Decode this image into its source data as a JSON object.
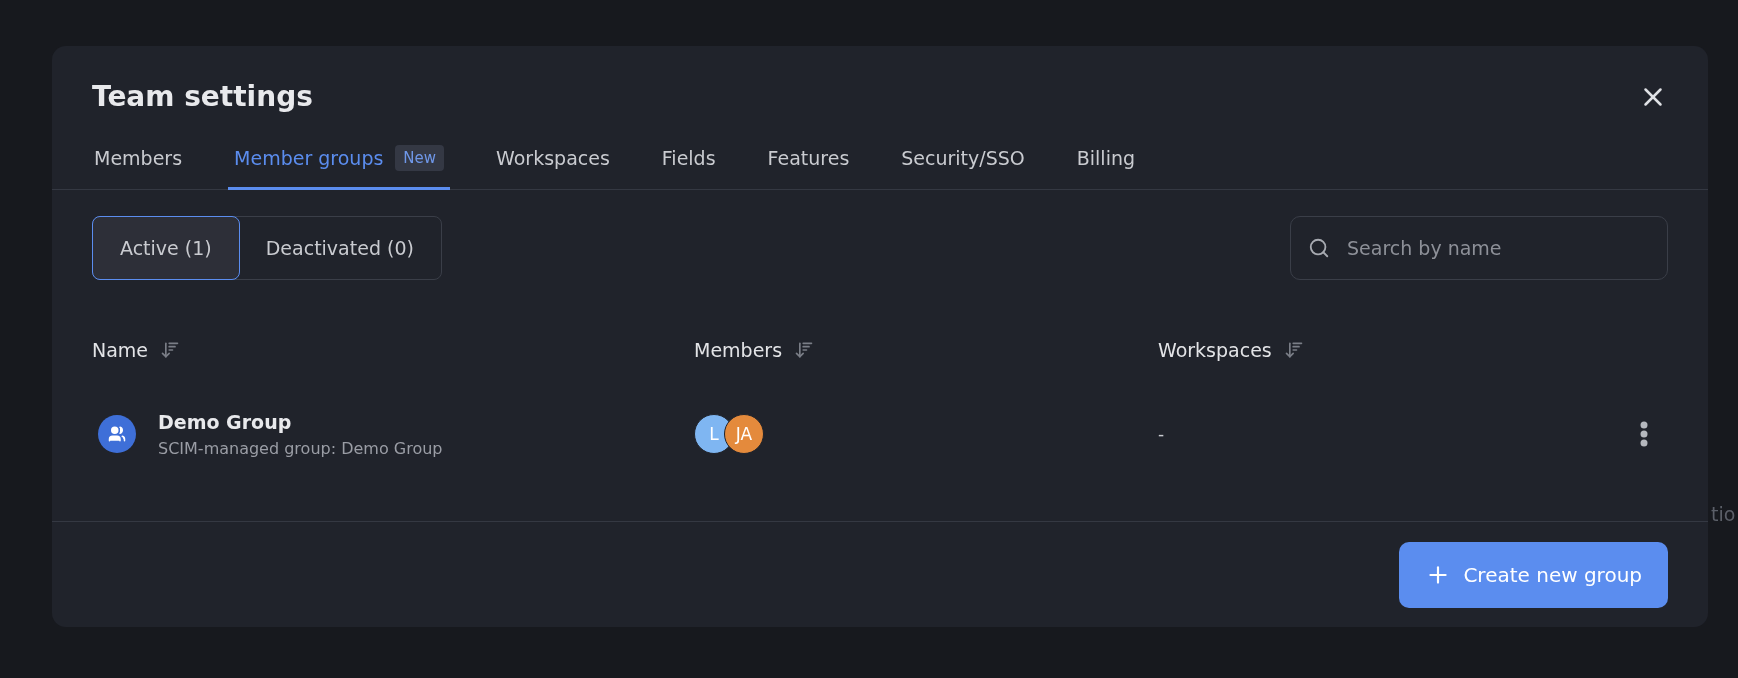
{
  "backdrop_text": "tio",
  "dialog": {
    "title": "Team settings"
  },
  "tabs": [
    {
      "label": "Members",
      "selected": false
    },
    {
      "label": "Member groups",
      "selected": true,
      "badge": "New"
    },
    {
      "label": "Workspaces",
      "selected": false
    },
    {
      "label": "Fields",
      "selected": false
    },
    {
      "label": "Features",
      "selected": false
    },
    {
      "label": "Security/SSO",
      "selected": false
    },
    {
      "label": "Billing",
      "selected": false
    }
  ],
  "filters": [
    {
      "label": "Active (1)",
      "selected": true
    },
    {
      "label": "Deactivated (0)",
      "selected": false
    }
  ],
  "search": {
    "placeholder": "Search by name"
  },
  "table": {
    "columns": [
      "Name",
      "Members",
      "Workspaces"
    ],
    "rows": [
      {
        "name": "Demo Group",
        "description": "SCIM-managed group: Demo Group",
        "members": [
          {
            "initials": "L",
            "color": "#7fb6f2"
          },
          {
            "initials": "JA",
            "color": "#e48a3c"
          }
        ],
        "workspaces": "-"
      }
    ]
  },
  "create_button": "Create new group"
}
